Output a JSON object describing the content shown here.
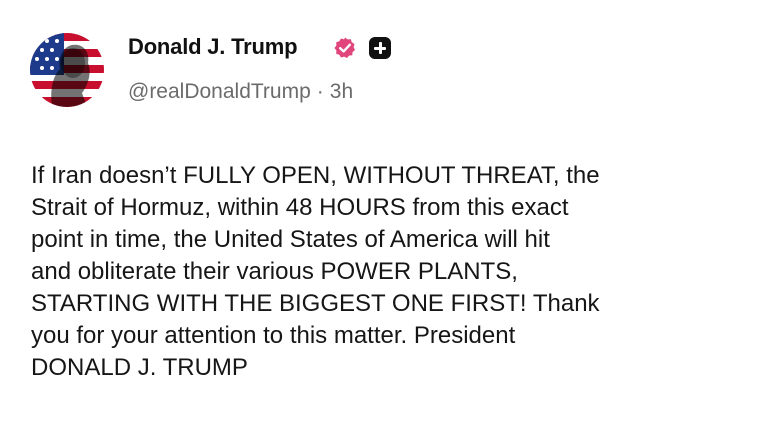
{
  "author": {
    "name": "Donald J. Trump",
    "handle": "@realDonaldTrump",
    "separator": "·",
    "time": "3h",
    "verified_color": "#e0457b",
    "avatar": "avatar-american-flag-portrait"
  },
  "icons": {
    "verified": "verified-badge-icon",
    "plus": "plus-badge-icon"
  },
  "post": {
    "lines": [
      "If Iran doesn’t FULLY OPEN, WITHOUT THREAT, the",
      "Strait of Hormuz, within 48 HOURS from this exact",
      "point in time, the United States of America will hit",
      "and obliterate their various POWER PLANTS,",
      "STARTING WITH THE BIGGEST ONE FIRST! Thank",
      "you for your attention to this matter. President",
      "DONALD J. TRUMP"
    ]
  }
}
